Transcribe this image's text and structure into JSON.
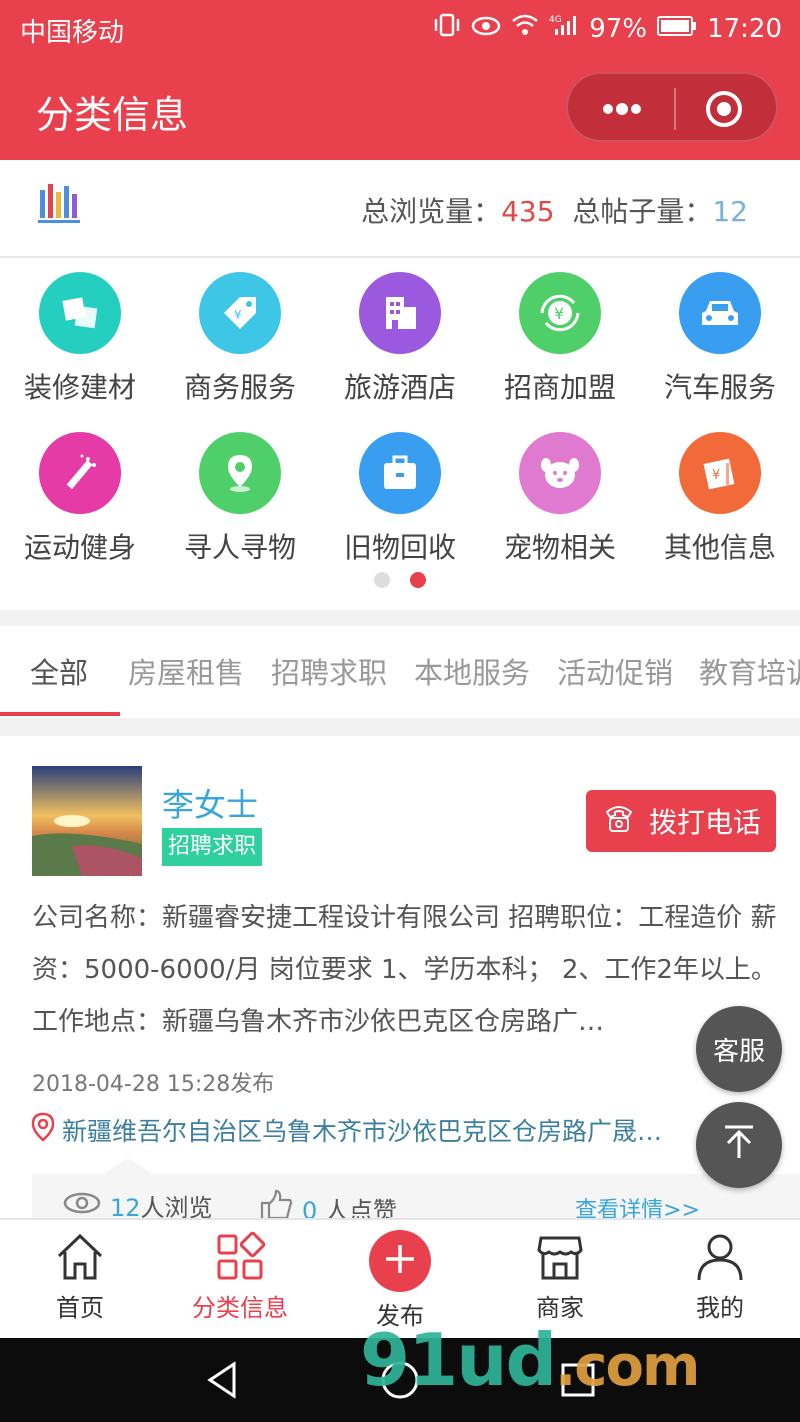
{
  "statusbar": {
    "carrier": "中国移动",
    "battery": "97%",
    "time": "17:20",
    "network": "4G"
  },
  "appbar": {
    "title": "分类信息"
  },
  "stats": {
    "views_label": "总浏览量：",
    "views_value": "435",
    "posts_label": "总帖子量：",
    "posts_value": "12"
  },
  "categories": [
    {
      "label": "装修建材",
      "color": "#25cfc0",
      "icon": "tiles-icon"
    },
    {
      "label": "商务服务",
      "color": "#3ec6e6",
      "icon": "price-tag-icon"
    },
    {
      "label": "旅游酒店",
      "color": "#9b59e0",
      "icon": "building-icon"
    },
    {
      "label": "招商加盟",
      "color": "#4fcf6a",
      "icon": "yuan-cycle-icon"
    },
    {
      "label": "汽车服务",
      "color": "#3a9ef0",
      "icon": "car-icon"
    },
    {
      "label": "运动健身",
      "color": "#e63aa6",
      "icon": "magic-wand-icon"
    },
    {
      "label": "寻人寻物",
      "color": "#4fcf6a",
      "icon": "location-pin-icon"
    },
    {
      "label": "旧物回收",
      "color": "#3a9ef0",
      "icon": "briefcase-icon"
    },
    {
      "label": "宠物相关",
      "color": "#e07ad0",
      "icon": "pet-face-icon"
    },
    {
      "label": "其他信息",
      "color": "#f26a3a",
      "icon": "ticket-icon"
    }
  ],
  "tabs": [
    "全部",
    "房屋租售",
    "招聘求职",
    "本地服务",
    "活动促销",
    "教育培训"
  ],
  "post": {
    "name": "李女士",
    "tag": "招聘求职",
    "call_label": "拨打电话",
    "description": "公司名称：新疆睿安捷工程设计有限公司 招聘职位：工程造价 薪资：5000-6000/月 岗位要求 1、学历本科； 2、工作2年以上。 工作地点：新疆乌鲁木齐市沙依巴克区仓房路广…",
    "date": "2018-04-28 15:28发布",
    "address": "新疆维吾尔自治区乌鲁木齐市沙依巴克区仓房路广晟…",
    "views_num": "12",
    "views_label": "人浏览",
    "likes_num": "0",
    "likes_label": " 人点赞",
    "detail_label": "查看详情>>"
  },
  "fab": {
    "service_label": "客服"
  },
  "tabbar": [
    {
      "label": "首页",
      "icon": "home-icon"
    },
    {
      "label": "分类信息",
      "icon": "category-grid-icon"
    },
    {
      "label": "发布",
      "icon": "plus-icon"
    },
    {
      "label": "商家",
      "icon": "shop-icon"
    },
    {
      "label": "我的",
      "icon": "user-icon"
    }
  ],
  "watermark": {
    "main": "91ud",
    "suffix": ".com"
  },
  "colors": {
    "primary": "#e8404c",
    "link": "#3aa6d8",
    "tag": "#2fcf9e"
  }
}
